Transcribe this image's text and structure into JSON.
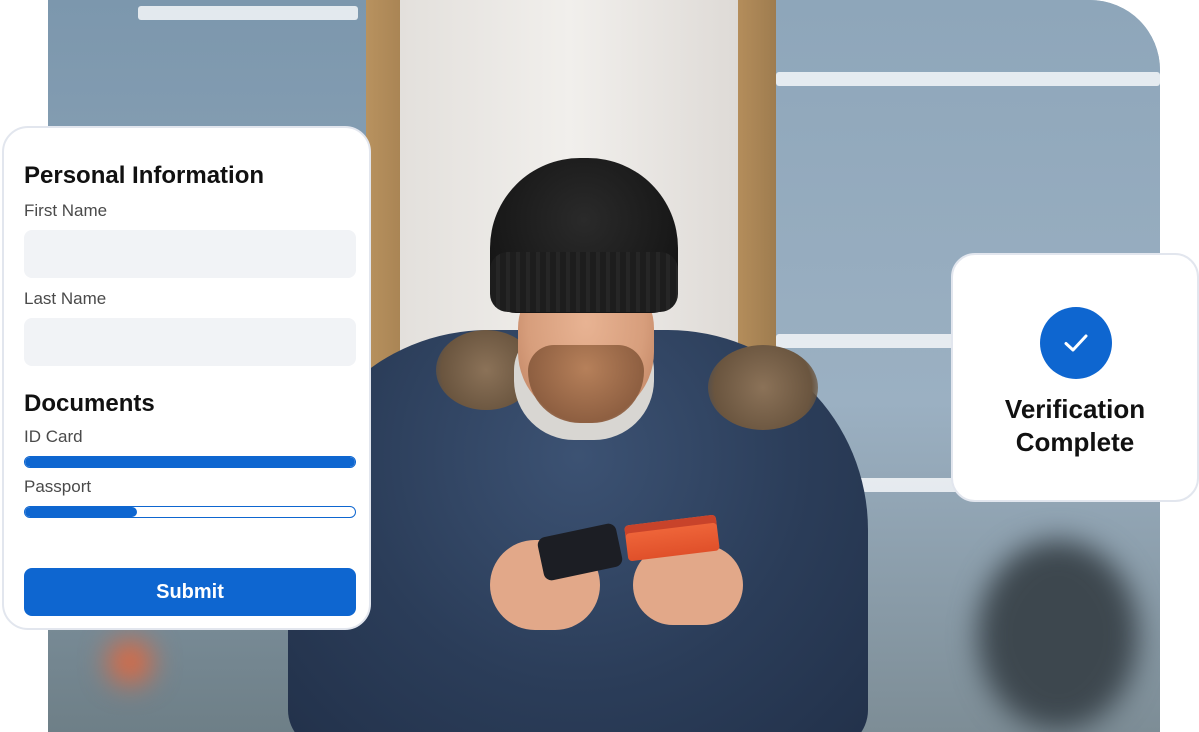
{
  "form": {
    "title": "Personal Information",
    "fields": [
      {
        "label": "First Name",
        "value": "",
        "placeholder": ""
      },
      {
        "label": "Last Name",
        "value": "",
        "placeholder": ""
      }
    ],
    "documents": {
      "title": "Documents",
      "items": [
        {
          "label": "ID Card",
          "progress": 1.0
        },
        {
          "label": "Passport",
          "progress": 0.34
        }
      ]
    },
    "submit_label": "Submit"
  },
  "verification": {
    "text": "Verification Complete",
    "icon": "checkmark-icon"
  },
  "colors": {
    "accent": "#0e66d0",
    "field_bg": "#f1f3f6",
    "card_border": "#e2e6ee"
  }
}
